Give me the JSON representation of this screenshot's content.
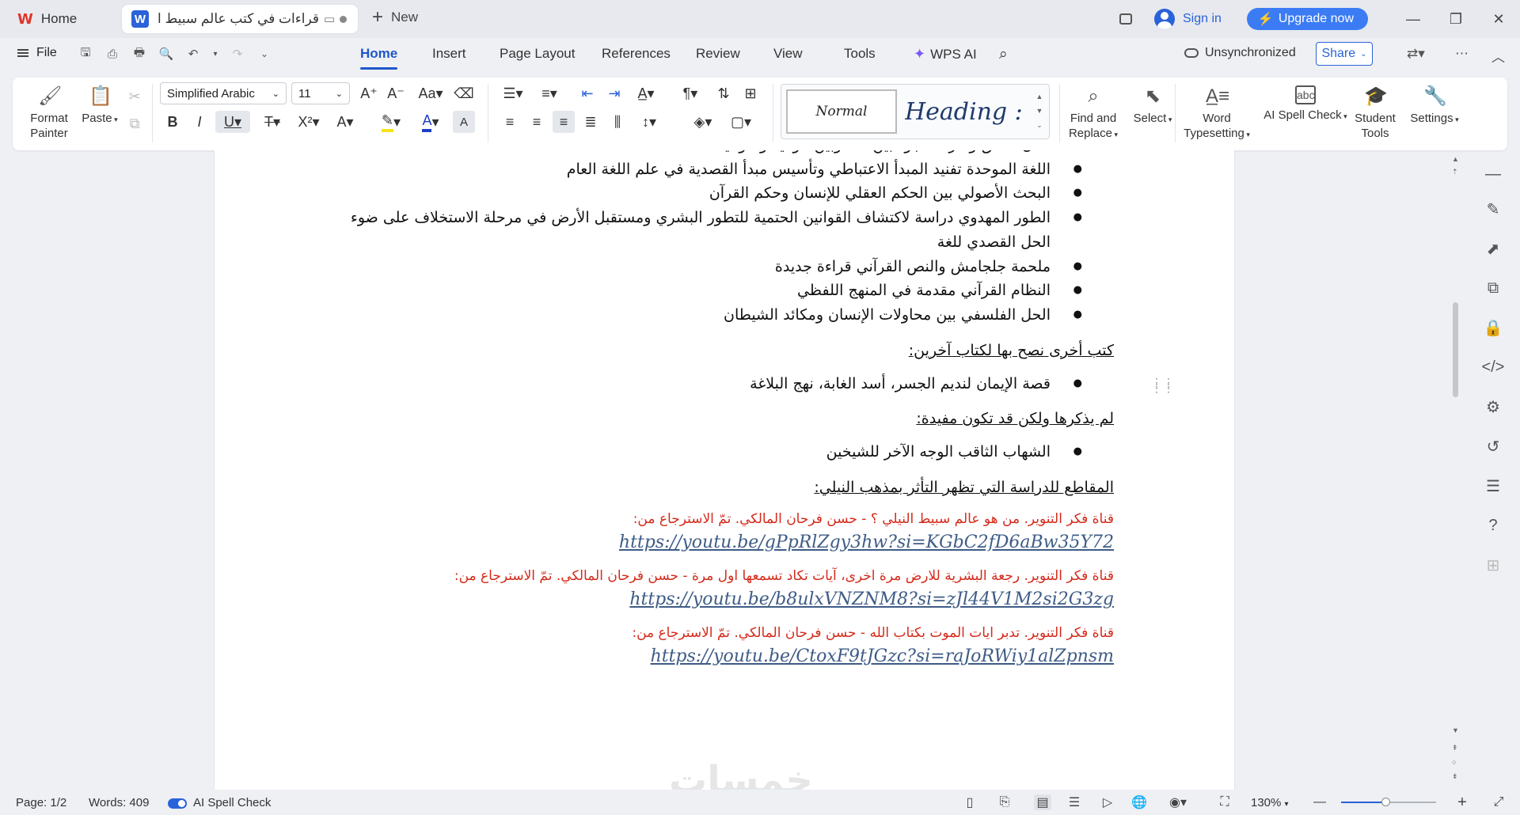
{
  "tabs": {
    "home_label": "Home",
    "doc_title": "قراءات في كتب عالم سبيط النيلي",
    "new_label": "New"
  },
  "window": {
    "sign_in": "Sign in",
    "upgrade": "Upgrade now"
  },
  "menu": {
    "file": "File",
    "items": [
      "Home",
      "Insert",
      "Page Layout",
      "References",
      "Review",
      "View",
      "Tools"
    ],
    "active": "Home",
    "wps_ai": "WPS AI",
    "sync_status": "Unsynchronized",
    "share": "Share"
  },
  "ribbon": {
    "format_painter": "Format Painter",
    "format_painter_l1": "Format",
    "format_painter_l2": "Painter",
    "paste": "Paste",
    "font_name": "Simplified Arabic",
    "font_size": "11",
    "style_normal": "Normal",
    "style_heading": "Heading :",
    "find_replace_l1": "Find and",
    "find_replace_l2": "Replace",
    "select": "Select",
    "word_typesetting_l1": "Word",
    "word_typesetting_l2": "Typesetting",
    "ai_spell_check": "AI Spell Check",
    "student_tools_l1": "Student",
    "student_tools_l2": "Tools",
    "settings": "Settings",
    "font_color": "#1f3fc2",
    "highlight_color": "#f5e31b"
  },
  "document": {
    "top_partial": "أصل الخلق وأمر السجود بين الأنا وبين الولاية والتوحيد",
    "bullets_1": [
      "اللغة الموحدة تفنيد المبدأ الاعتباطي وتأسيس مبدأ القصدية في علم اللغة العام",
      "البحث الأصولي بين الحكم العقلي للإنسان وحكم القرآن",
      "الطور المهدوي  دراسة لاكتشاف القوانين الحتمية للتطور البشري ومستقبل الأرض في مرحلة الاستخلاف على ضوء الحل القصدي للغة",
      "ملحمة جلجامش والنص القرآني قراءة جديدة",
      "النظام القرآني مقدمة في المنهج اللفظي",
      "الحل الفلسفي بين محاولات الإنسان ومكائد الشيطان"
    ],
    "heading_other_books": "كتب أخرى نصح بها لكتاب آخرين:",
    "bullets_2": [
      "قصة الإيمان لنديم الجسر، أسد الغابة، نهج البلاغة"
    ],
    "heading_not_mentioned": "لم يذكرها ولكن قد تكون مفيدة:",
    "bullets_3": [
      "الشهاب الثاقب الوجه الآخر للشيخين"
    ],
    "heading_clips": "المقاطع للدراسة التي تظهر التأثر بمذهب النيلي:",
    "references": [
      {
        "text": "قناة فكر التنوير. من هو عالم سبيط النيلي ؟ - حسن فرحان المالكي. تمّ الاسترجاع من:",
        "link": "https://youtu.be/gPpRlZgy3hw?si=KGbC2fD6aBw35Y72"
      },
      {
        "text": "قناة فكر التنوير. رجعة البشرية للارض مرة اخرى، آيات تكاد تسمعها اول مرة - حسن فرحان المالكي. تمّ الاسترجاع من:",
        "link": "https://youtu.be/b8ulxVNZNM8?si=zJl44V1M2si2G3zg"
      },
      {
        "text": "قناة فكر التنوير. تدبر ايات الموت بكتاب الله - حسن فرحان المالكي. تمّ الاسترجاع من:",
        "link": "https://youtu.be/CtoxF9tJGzc?si=raJoRWiy1alZpnsm"
      }
    ],
    "watermark": "خمسات"
  },
  "status": {
    "page": "Page: 1/2",
    "words": "Words: 409",
    "ai_spell_check": "AI Spell Check",
    "zoom": "130%",
    "zoom_fraction": 0.47
  }
}
